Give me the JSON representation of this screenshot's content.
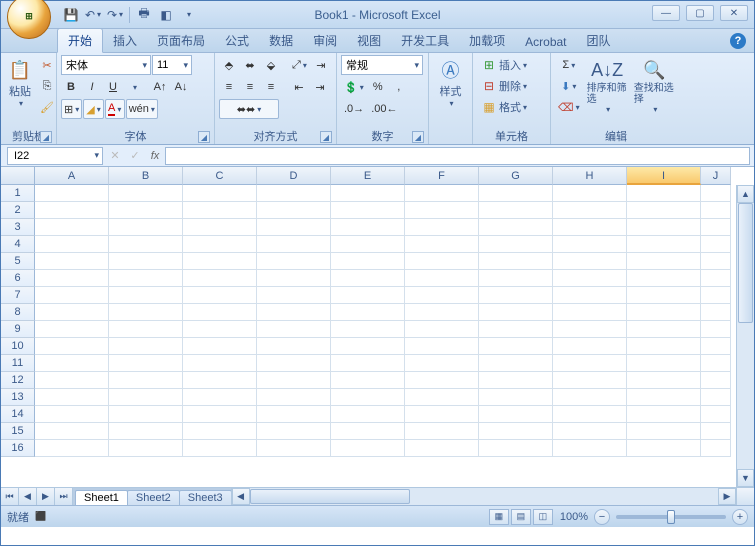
{
  "title": "Book1 - Microsoft Excel",
  "tabs": [
    "开始",
    "插入",
    "页面布局",
    "公式",
    "数据",
    "审阅",
    "视图",
    "开发工具",
    "加载项",
    "Acrobat",
    "团队"
  ],
  "active_tab": 0,
  "clipboard": {
    "paste": "粘贴",
    "label": "剪贴板"
  },
  "font": {
    "name": "宋体",
    "size": "11",
    "bold": "B",
    "italic": "I",
    "underline": "U",
    "label": "字体"
  },
  "align": {
    "normal": "常规",
    "label": "对齐方式"
  },
  "number": {
    "label": "数字"
  },
  "styles": {
    "btn": "样式"
  },
  "cells": {
    "insert": "插入",
    "delete": "删除",
    "format": "格式",
    "label": "单元格"
  },
  "editing": {
    "sort": "排序和筛选",
    "find": "查找和选择",
    "label": "编辑"
  },
  "namebox": "I22",
  "cols": [
    "A",
    "B",
    "C",
    "D",
    "E",
    "F",
    "G",
    "H",
    "I",
    "J"
  ],
  "rows": [
    "1",
    "2",
    "3",
    "4",
    "5",
    "6",
    "7",
    "8",
    "9",
    "10",
    "11",
    "12",
    "13",
    "14",
    "15",
    "16"
  ],
  "sheets": [
    "Sheet1",
    "Sheet2",
    "Sheet3"
  ],
  "active_sheet": 0,
  "status": "就绪",
  "zoom": "100%"
}
